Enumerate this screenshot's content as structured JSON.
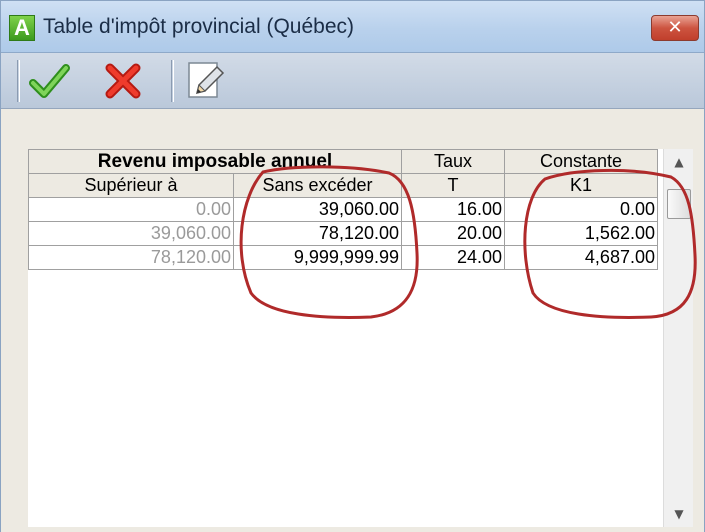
{
  "window": {
    "title": "Table d'impôt provincial (Québec)",
    "app_icon_letter": "A",
    "close_symbol": "✕"
  },
  "toolbar": {
    "buttons": [
      {
        "name": "ok-button",
        "icon": "checkmark-icon",
        "color": "#3fa52a"
      },
      {
        "name": "cancel-button",
        "icon": "red-x-icon",
        "color": "#d8221a"
      },
      {
        "name": "edit-button",
        "icon": "pencil-icon"
      }
    ]
  },
  "table": {
    "headers_row1": [
      "Revenu imposable annuel",
      "Taux",
      "Constante"
    ],
    "headers_row2": [
      "Supérieur à",
      "Sans excéder",
      "T",
      "K1"
    ],
    "rows": [
      [
        "0.00",
        "39,060.00",
        "16.00",
        "0.00"
      ],
      [
        "39,060.00",
        "78,120.00",
        "20.00",
        "1,562.00"
      ],
      [
        "78,120.00",
        "9,999,999.99",
        "24.00",
        "4,687.00"
      ]
    ]
  },
  "scrollbar": {
    "up_symbol": "▲",
    "down_symbol": "▼"
  },
  "annotation_color": "#b02a2a"
}
